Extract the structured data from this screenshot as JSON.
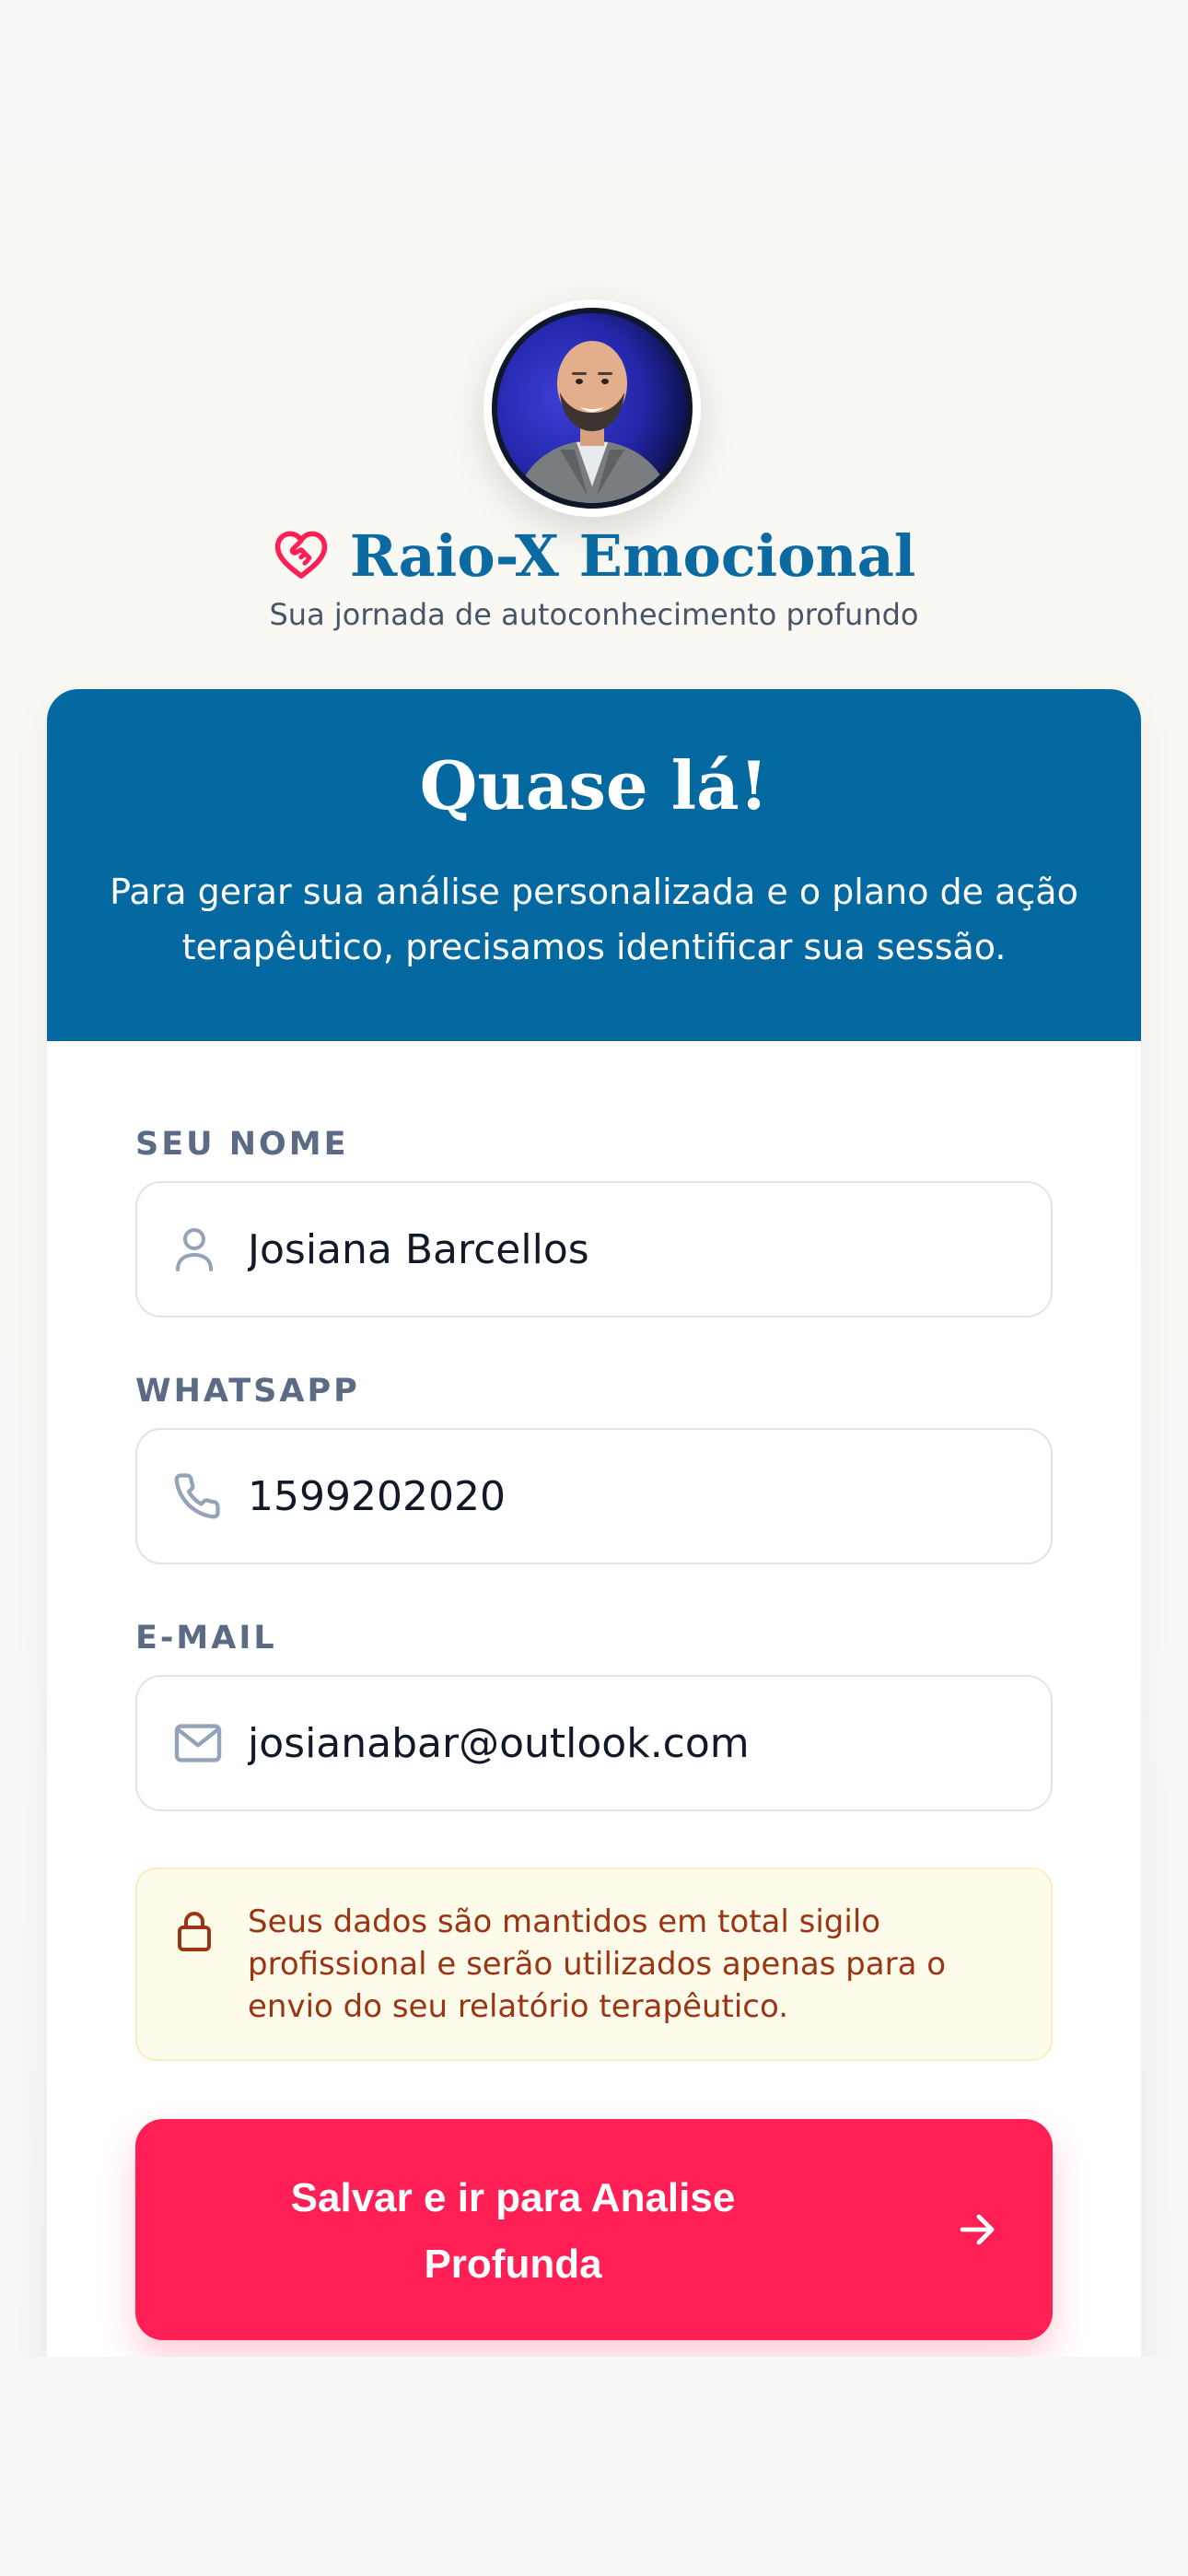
{
  "brand": {
    "title": "Raio-X Emocional",
    "tagline": "Sua jornada de autoconhecimento profundo",
    "icon": "heart-handshake-icon",
    "accent_color": "#ff1f55",
    "title_color": "#0b6aa2"
  },
  "card": {
    "title": "Quase lá!",
    "subtitle": "Para gerar sua análise personalizada e o plano de ação terapêutico, precisamos identificar sua sessão.",
    "header_color": "#0569a1"
  },
  "form": {
    "name": {
      "label": "SEU NOME",
      "value": "Josiana Barcellos",
      "icon": "user-icon"
    },
    "whatsapp": {
      "label": "WHATSAPP",
      "value": "1599202020",
      "icon": "phone-icon"
    },
    "email": {
      "label": "E-MAIL",
      "value": "josianabar@outlook.com",
      "icon": "mail-icon"
    }
  },
  "notice": {
    "icon": "lock-icon",
    "text": "Seus dados são mantidos em total sigilo profissional e serão utilizados apenas para o envio do seu relatório terapêutico."
  },
  "cta": {
    "label": "Salvar e ir para Analise Profunda",
    "icon": "arrow-right-icon",
    "color": "#ff1f55"
  }
}
